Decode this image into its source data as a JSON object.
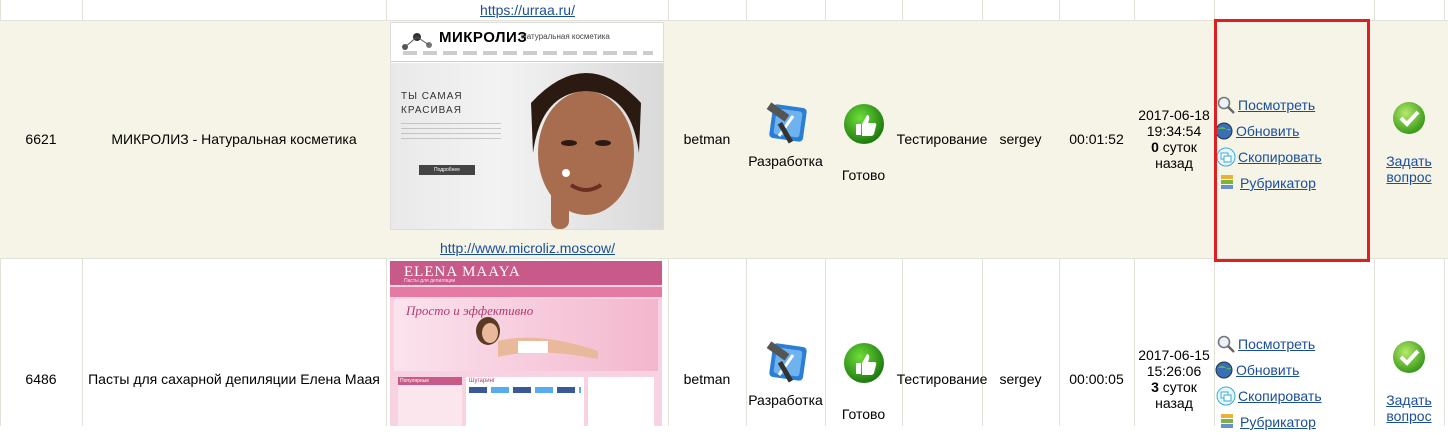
{
  "top_link": "https://urraa.ru/",
  "rows": [
    {
      "id": "6621",
      "title": "МИКРОЛИЗ - Натуральная косметика",
      "site_url": "http://www.microliz.moscow/",
      "shot": {
        "brand": "МИКРОЛИЗ",
        "tagline": "Натуральная косметика",
        "headline1": "ТЫ САМАЯ",
        "headline2": "КРАСИВАЯ",
        "button": "Подробнее"
      },
      "owner": "betman",
      "dev_label": "Разработка",
      "ready_label": "Готово",
      "stage": "Тестирование",
      "assignee": "sergey",
      "time": "00:01:52",
      "date": "2017-06-18",
      "clock": "19:34:54",
      "days": "0",
      "days_suffix": "суток назад"
    },
    {
      "id": "6486",
      "title": "Пасты для сахарной депиляции Елена Маая",
      "site_url": "",
      "shot": {
        "brand": "ELENA MAAYA",
        "tagline": "Пасты для депиляции",
        "headline1": "Просто и эффективно",
        "sidebar_title": "Популярные",
        "content_title": "Шугаринг"
      },
      "owner": "betman",
      "dev_label": "Разработка",
      "ready_label": "Готово",
      "stage": "Тестирование",
      "assignee": "sergey",
      "time": "00:00:05",
      "date": "2017-06-15",
      "clock": "15:26:06",
      "days": "3",
      "days_suffix": "суток назад"
    }
  ],
  "actions": {
    "view": "Посмотреть",
    "update": "Обновить",
    "copy": "Скопировать",
    "rubric": "Рубрикатор"
  },
  "ask_label": "Задать вопрос",
  "colors": {
    "link": "#1a4e9a",
    "highlight_row": "#f5f4e6",
    "annotation_frame": "#e02020",
    "ok_green": "#3a9a1a"
  }
}
